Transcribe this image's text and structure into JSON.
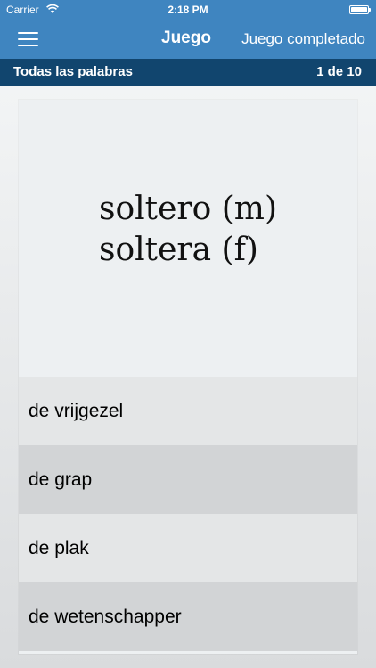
{
  "status_bar": {
    "carrier": "Carrier",
    "time": "2:18 PM",
    "icons": [
      "wifi-icon",
      "battery-icon"
    ]
  },
  "nav": {
    "title": "Juego",
    "action": "Juego completado",
    "menu_icon": "hamburger-menu-icon",
    "color": "#3f85c0"
  },
  "sub_header": {
    "left": "Todas las palabras",
    "progress": "1 de 10",
    "color": "#11456e"
  },
  "card": {
    "prompt_lines": [
      "soltero (m)",
      "soltera (f)"
    ],
    "options": [
      "de vrijgezel",
      "de grap",
      "de plak",
      "de wetenschapper"
    ]
  }
}
